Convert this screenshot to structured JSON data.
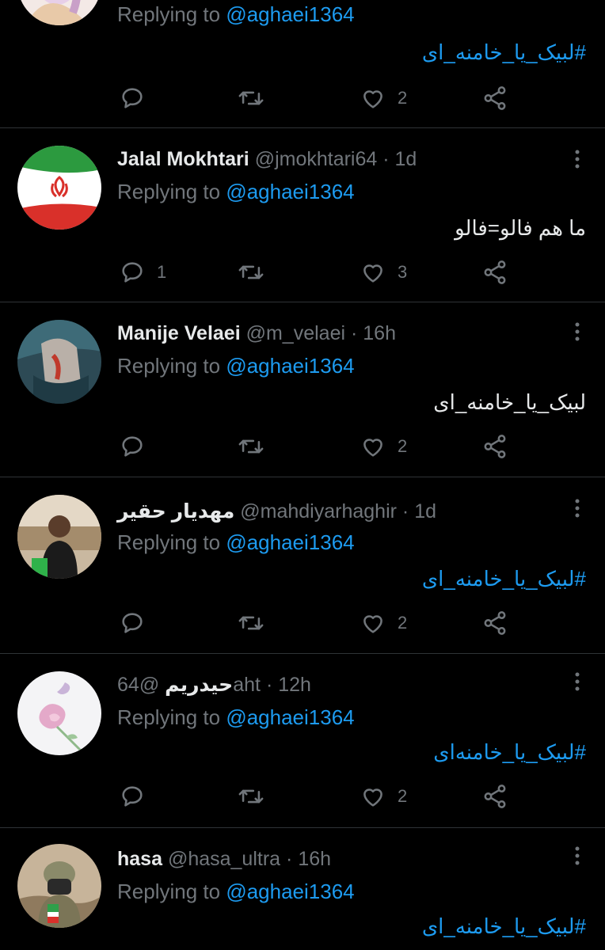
{
  "tweets": [
    {
      "name": "",
      "handle": "",
      "dot": "",
      "time": "",
      "replying_prefix": "Replying to ",
      "replying_mention": "@aghaei1364",
      "text": "#لبیک_یا_خامنه_ای",
      "text_is_hashtag": true,
      "reply_count": "",
      "retweet_count": "",
      "like_count": "2",
      "avatar": "avatar-illustration"
    },
    {
      "name": "Jalal Mokhtari",
      "handle": "@jmokhtari64",
      "dot": "·",
      "time": "1d",
      "replying_prefix": "Replying to ",
      "replying_mention": "@aghaei1364",
      "text": "ما هم فالو=فالو",
      "text_is_hashtag": false,
      "reply_count": "1",
      "retweet_count": "",
      "like_count": "3",
      "avatar": "iran-flag-avatar"
    },
    {
      "name": "Manije Velaei",
      "handle": "@m_velaei",
      "dot": "·",
      "time": "16h",
      "replying_prefix": "Replying to ",
      "replying_mention": "@aghaei1364",
      "text": "لبیک_یا_خامنه_ای",
      "text_is_hashtag": false,
      "reply_count": "",
      "retweet_count": "",
      "like_count": "2",
      "avatar": "avatar-photo"
    },
    {
      "name": "مهدیار حقیر",
      "handle": "@mahdiyarhaghir",
      "dot": "·",
      "time": "1d",
      "replying_prefix": "Replying to ",
      "replying_mention": "@aghaei1364",
      "text": "#لبیک_یا_خامنه_ای",
      "text_is_hashtag": true,
      "reply_count": "",
      "retweet_count": "",
      "like_count": "2",
      "avatar": "avatar-photo"
    },
    {
      "name": "حیدریم",
      "handle": "@64aht",
      "dot": "·",
      "time": "12h",
      "replying_prefix": "Replying to ",
      "replying_mention": "@aghaei1364",
      "text": "#لبیک_یا_خامنه‌ای",
      "text_is_hashtag": true,
      "reply_count": "",
      "retweet_count": "",
      "like_count": "2",
      "avatar": "rose-avatar"
    },
    {
      "name": "hasa",
      "handle": "@hasa_ultra",
      "dot": "·",
      "time": "16h",
      "replying_prefix": "Replying to ",
      "replying_mention": "@aghaei1364",
      "text": "#لبیک_یا_خامنه_ای",
      "text_is_hashtag": true,
      "reply_count": "",
      "retweet_count": "",
      "like_count": "",
      "avatar": "soldier-avatar"
    }
  ],
  "colors": {
    "background": "#000000",
    "text": "#e7e9ea",
    "muted": "#71767b",
    "accent": "#1d9bf0",
    "divider": "#2f3336"
  },
  "icons": {
    "reply": "reply-icon",
    "retweet": "retweet-icon",
    "like": "like-icon",
    "share": "share-icon",
    "more": "more-icon"
  }
}
